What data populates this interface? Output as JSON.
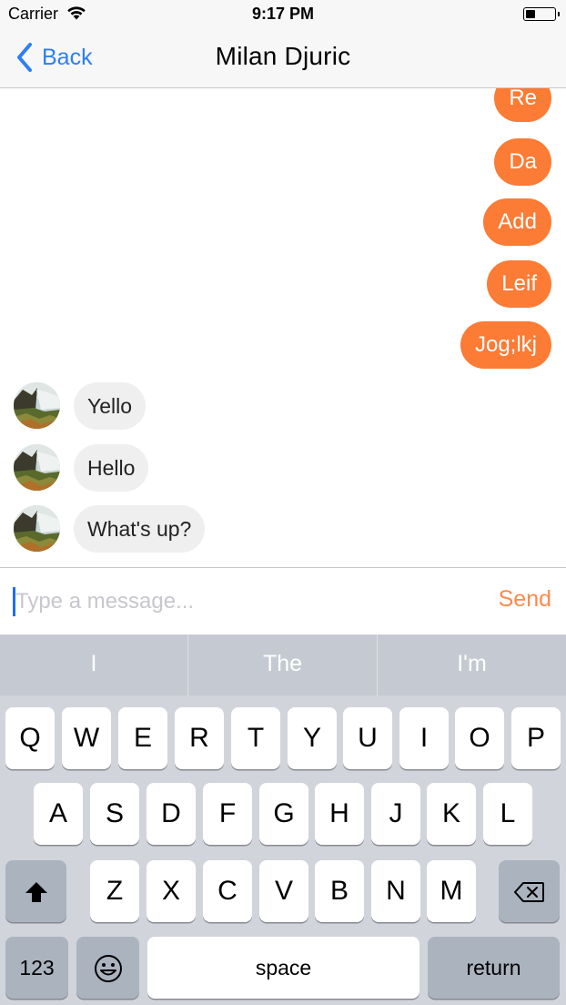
{
  "status_bar": {
    "carrier": "Carrier",
    "time": "9:17 PM"
  },
  "nav": {
    "back_label": "Back",
    "title": "Milan Djuric"
  },
  "messages": {
    "outgoing": [
      "Re",
      "Da",
      "Add",
      "Leif",
      "Jog;lkj"
    ],
    "incoming": [
      "Yello",
      "Hello",
      "What's up?"
    ]
  },
  "composer": {
    "placeholder": "Type a message...",
    "value": "",
    "send_label": "Send"
  },
  "keyboard": {
    "suggestions": [
      "I",
      "The",
      "I'm"
    ],
    "row1": [
      "Q",
      "W",
      "E",
      "R",
      "T",
      "Y",
      "U",
      "I",
      "O",
      "P"
    ],
    "row2": [
      "A",
      "S",
      "D",
      "F",
      "G",
      "H",
      "J",
      "K",
      "L"
    ],
    "row3": [
      "Z",
      "X",
      "C",
      "V",
      "B",
      "N",
      "M"
    ],
    "numbers_label": "123",
    "space_label": "space",
    "return_label": "return",
    "shift_icon": "shift-icon",
    "delete_icon": "backspace-icon",
    "emoji_icon": "emoji-icon"
  },
  "colors": {
    "accent": "#fc7b35",
    "nav_link": "#2d7ff5",
    "incoming_bubble": "#efefef"
  }
}
